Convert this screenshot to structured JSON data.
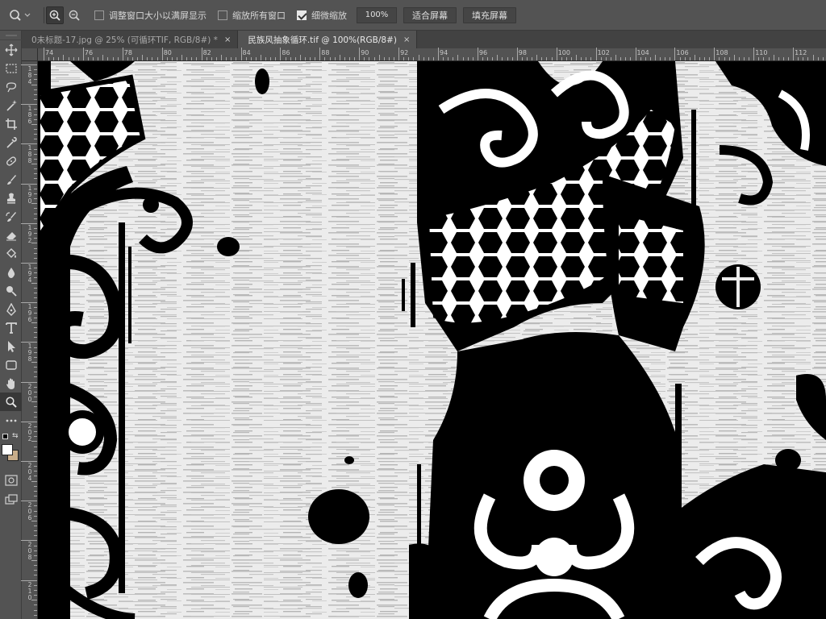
{
  "options_bar": {
    "resize_windows_label": "调整窗口大小以满屏显示",
    "resize_windows_checked": false,
    "zoom_all_windows_label": "缩放所有窗口",
    "zoom_all_windows_checked": false,
    "scrubby_zoom_label": "细微缩放",
    "scrubby_zoom_checked": true,
    "zoom_value": "100%",
    "fit_screen_label": "适合屏幕",
    "fill_screen_label": "填充屏幕"
  },
  "tabs": [
    {
      "label": "0未标题-17.jpg @ 25% (可循环TIF, RGB/8#) *",
      "active": false,
      "close": "×"
    },
    {
      "label": "民族风抽象循环.tif @ 100%(RGB/8#)",
      "active": true,
      "close": "×"
    }
  ],
  "ruler_top_labels": [
    "74",
    "76",
    "78",
    "80",
    "82",
    "84",
    "86",
    "88",
    "90",
    "92",
    "94",
    "96",
    "98",
    "100",
    "102",
    "104",
    "106",
    "108",
    "110",
    "112"
  ],
  "ruler_left_labels": [
    "184",
    "186",
    "188",
    "190",
    "192",
    "194",
    "196",
    "198",
    "200",
    "202",
    "204",
    "206",
    "208",
    "210"
  ],
  "tools": [
    "move-tool-icon",
    "marquee-tool-icon",
    "lasso-tool-icon",
    "magic-wand-tool-icon",
    "crop-tool-icon",
    "eyedropper-tool-icon",
    "healing-brush-tool-icon",
    "brush-tool-icon",
    "clone-stamp-tool-icon",
    "history-brush-tool-icon",
    "eraser-tool-icon",
    "paint-bucket-tool-icon",
    "blur-tool-icon",
    "dodge-tool-icon",
    "pen-tool-icon",
    "type-tool-icon",
    "path-selection-tool-icon",
    "rectangle-tool-icon",
    "hand-tool-icon",
    "zoom-tool-icon",
    "more-tools-icon"
  ],
  "colors": {
    "foreground": "#ffffff",
    "background": "#c8ad8a",
    "ui_bg": "#535353",
    "canvas_paper": "#ececec",
    "ink": "#000000"
  }
}
